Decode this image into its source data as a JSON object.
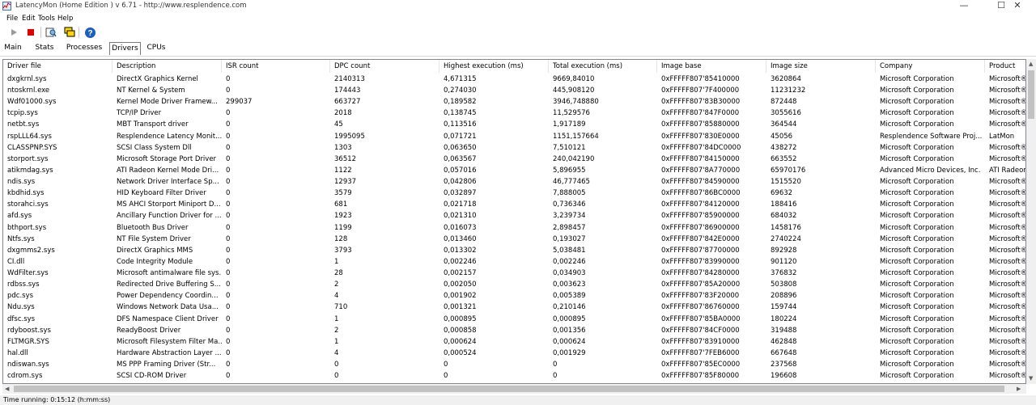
{
  "window": {
    "title": "LatencyMon  (Home Edition )  v 6.71 - http://www.resplendence.com",
    "minimize": "—",
    "maximize": "☐",
    "close": "✕"
  },
  "menu": [
    "File",
    "Edit",
    "Tools",
    "Help"
  ],
  "toolbar": {
    "icons": [
      "play-icon",
      "stop-icon",
      "report-icon",
      "monitor-icon",
      "help-icon"
    ],
    "colors": {
      "stop": "#e00000",
      "help": "#1a5fbf"
    }
  },
  "tabs": [
    {
      "label": "Main",
      "active": false
    },
    {
      "label": "Stats",
      "active": false
    },
    {
      "label": "Processes",
      "active": false
    },
    {
      "label": "Drivers",
      "active": true
    },
    {
      "label": "CPUs",
      "active": false
    }
  ],
  "table": {
    "columns": [
      "Driver file",
      "Description",
      "ISR count",
      "DPC count",
      "Highest execution (ms)",
      "Total execution (ms)",
      "Image base",
      "Image size",
      "Company",
      "Product"
    ],
    "rows": [
      [
        "dxgkrnl.sys",
        "DirectX Graphics Kernel",
        "0",
        "2140313",
        "4,671315",
        "9669,84010",
        "0xFFFFF807'85410000",
        "3620864",
        "Microsoft Corporation",
        "Microsoft®"
      ],
      [
        "ntoskrnl.exe",
        "NT Kernel & System",
        "0",
        "174443",
        "0,274030",
        "445,908120",
        "0xFFFFF807'7F400000",
        "11231232",
        "Microsoft Corporation",
        "Microsoft®"
      ],
      [
        "Wdf01000.sys",
        "Kernel Mode Driver Framew...",
        "299037",
        "663727",
        "0,189582",
        "3946,748880",
        "0xFFFFF807'83B30000",
        "872448",
        "Microsoft Corporation",
        "Microsoft®"
      ],
      [
        "tcpip.sys",
        "TCP/IP Driver",
        "0",
        "2018",
        "0,138745",
        "11,529576",
        "0xFFFFF807'847F0000",
        "3055616",
        "Microsoft Corporation",
        "Microsoft®"
      ],
      [
        "netbt.sys",
        "MBT Transport driver",
        "0",
        "45",
        "0,113516",
        "1,917189",
        "0xFFFFF807'85880000",
        "364544",
        "Microsoft Corporation",
        "Microsoft®"
      ],
      [
        "rspLLL64.sys",
        "Resplendence Latency Monit...",
        "0",
        "1995095",
        "0,071721",
        "1151,157664",
        "0xFFFFF807'830E0000",
        "45056",
        "Resplendence Software Proj...",
        "LatMon"
      ],
      [
        "CLASSPNP.SYS",
        "SCSI Class System Dll",
        "0",
        "1303",
        "0,063650",
        "7,510121",
        "0xFFFFF807'84DC0000",
        "438272",
        "Microsoft Corporation",
        "Microsoft®"
      ],
      [
        "storport.sys",
        "Microsoft Storage Port Driver",
        "0",
        "36512",
        "0,063567",
        "240,042190",
        "0xFFFFF807'84150000",
        "663552",
        "Microsoft Corporation",
        "Microsoft®"
      ],
      [
        "atikmdag.sys",
        "ATI Radeon Kernel Mode Dri...",
        "0",
        "1122",
        "0,057016",
        "5,896955",
        "0xFFFFF807'8A770000",
        "65970176",
        "Advanced Micro Devices, Inc.",
        "ATI Radeon"
      ],
      [
        "ndis.sys",
        "Network Driver Interface Sp...",
        "0",
        "12937",
        "0,042806",
        "46,777465",
        "0xFFFFF807'84590000",
        "1515520",
        "Microsoft Corporation",
        "Microsoft®"
      ],
      [
        "kbdhid.sys",
        "HID Keyboard Filter Driver",
        "0",
        "3579",
        "0,032897",
        "7,888005",
        "0xFFFFF807'86BC0000",
        "69632",
        "Microsoft Corporation",
        "Microsoft®"
      ],
      [
        "storahci.sys",
        "MS AHCI Storport Miniport D...",
        "0",
        "681",
        "0,021718",
        "0,736346",
        "0xFFFFF807'84120000",
        "188416",
        "Microsoft Corporation",
        "Microsoft®"
      ],
      [
        "afd.sys",
        "Ancillary Function Driver for ...",
        "0",
        "1923",
        "0,021310",
        "3,239734",
        "0xFFFFF807'85900000",
        "684032",
        "Microsoft Corporation",
        "Microsoft®"
      ],
      [
        "bthport.sys",
        "Bluetooth Bus Driver",
        "0",
        "1199",
        "0,016073",
        "2,898457",
        "0xFFFFF807'86900000",
        "1458176",
        "Microsoft Corporation",
        "Microsoft®"
      ],
      [
        "Ntfs.sys",
        "NT File System Driver",
        "0",
        "128",
        "0,013460",
        "0,193027",
        "0xFFFFF807'842E0000",
        "2740224",
        "Microsoft Corporation",
        "Microsoft®"
      ],
      [
        "dxgmms2.sys",
        "DirectX Graphics MMS",
        "0",
        "3793",
        "0,013302",
        "5,038481",
        "0xFFFFF807'87700000",
        "892928",
        "Microsoft Corporation",
        "Microsoft®"
      ],
      [
        "CI.dll",
        "Code Integrity Module",
        "0",
        "1",
        "0,002246",
        "0,002246",
        "0xFFFFF807'83990000",
        "901120",
        "Microsoft Corporation",
        "Microsoft®"
      ],
      [
        "WdFilter.sys",
        "Microsoft antimalware file sys...",
        "0",
        "28",
        "0,002157",
        "0,034903",
        "0xFFFFF807'84280000",
        "376832",
        "Microsoft Corporation",
        "Microsoft®"
      ],
      [
        "rdbss.sys",
        "Redirected Drive Buffering S...",
        "0",
        "2",
        "0,002050",
        "0,003623",
        "0xFFFFF807'85A20000",
        "503808",
        "Microsoft Corporation",
        "Microsoft®"
      ],
      [
        "pdc.sys",
        "Power Dependency Coordin...",
        "0",
        "4",
        "0,001902",
        "0,005389",
        "0xFFFFF807'83F20000",
        "208896",
        "Microsoft Corporation",
        "Microsoft®"
      ],
      [
        "Ndu.sys",
        "Windows Network Data Usa...",
        "0",
        "710",
        "0,001321",
        "0,210146",
        "0xFFFFF807'86760000",
        "159744",
        "Microsoft Corporation",
        "Microsoft®"
      ],
      [
        "dfsc.sys",
        "DFS Namespace Client Driver",
        "0",
        "1",
        "0,000895",
        "0,000895",
        "0xFFFFF807'85BA0000",
        "180224",
        "Microsoft Corporation",
        "Microsoft®"
      ],
      [
        "rdyboost.sys",
        "ReadyBoost Driver",
        "0",
        "2",
        "0,000858",
        "0,001356",
        "0xFFFFF807'84CF0000",
        "319488",
        "Microsoft Corporation",
        "Microsoft®"
      ],
      [
        "FLTMGR.SYS",
        "Microsoft Filesystem Filter Ma...",
        "0",
        "1",
        "0,000624",
        "0,000624",
        "0xFFFFF807'83910000",
        "462848",
        "Microsoft Corporation",
        "Microsoft®"
      ],
      [
        "hal.dll",
        "Hardware Abstraction Layer ...",
        "0",
        "4",
        "0,000524",
        "0,001929",
        "0xFFFFF807'7FEB6000",
        "667648",
        "Microsoft Corporation",
        "Microsoft®"
      ],
      [
        "ndiswan.sys",
        "MS PPP Framing Driver (Str...",
        "0",
        "0",
        "0",
        "0",
        "0xFFFFF807'85EC0000",
        "237568",
        "Microsoft Corporation",
        "Microsoft®"
      ],
      [
        "cdrom.sys",
        "SCSI CD-ROM Driver",
        "0",
        "0",
        "0",
        "0",
        "0xFFFFF807'85F80000",
        "196608",
        "Microsoft Corporation",
        "Microsoft®"
      ]
    ]
  },
  "status": {
    "text": "Time running: 0:15:12  (h:mm:ss)"
  }
}
